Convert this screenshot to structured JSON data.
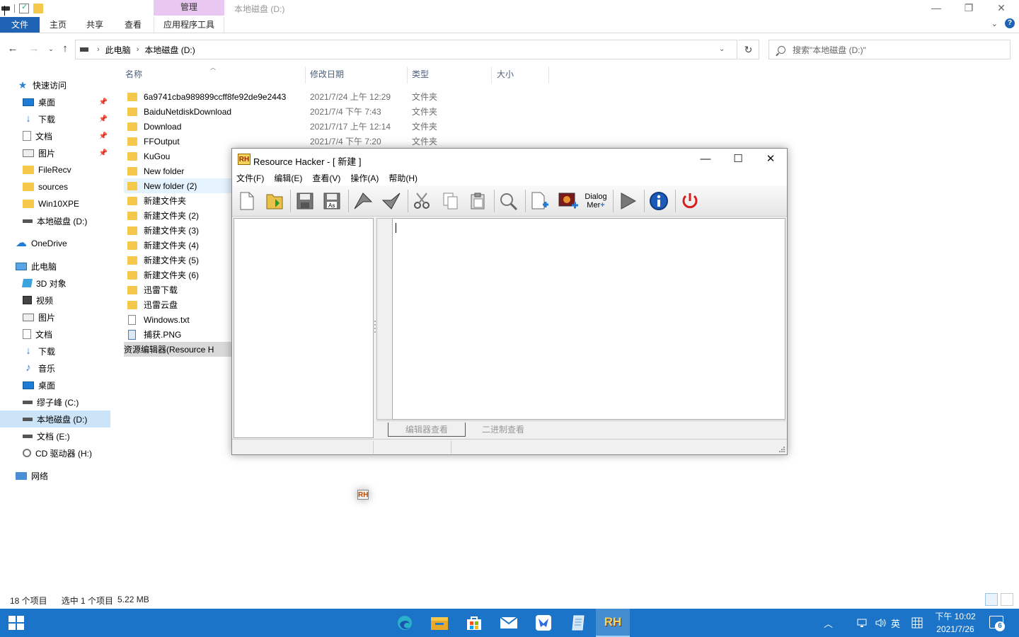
{
  "explorer": {
    "context_tab": "管理",
    "window_title": "本地磁盘 (D:)",
    "ribbon_tabs": [
      "文件",
      "主页",
      "共享",
      "查看",
      "应用程序工具"
    ],
    "breadcrumb": [
      "此电脑",
      "本地磁盘 (D:)"
    ],
    "search_placeholder": "搜索\"本地磁盘 (D:)\"",
    "columns": [
      "名称",
      "修改日期",
      "类型",
      "大小"
    ],
    "nav": [
      {
        "label": "快速访问"
      },
      {
        "label": "桌面"
      },
      {
        "label": "下载"
      },
      {
        "label": "文档"
      },
      {
        "label": "图片"
      },
      {
        "label": "FileRecv"
      },
      {
        "label": "sources"
      },
      {
        "label": "Win10XPE"
      },
      {
        "label": "本地磁盘 (D:)"
      },
      {
        "label": "OneDrive"
      },
      {
        "label": "此电脑"
      },
      {
        "label": "3D 对象"
      },
      {
        "label": "视频"
      },
      {
        "label": "图片"
      },
      {
        "label": "文档"
      },
      {
        "label": "下载"
      },
      {
        "label": "音乐"
      },
      {
        "label": "桌面"
      },
      {
        "label": "缪子峰 (C:)"
      },
      {
        "label": "本地磁盘 (D:)"
      },
      {
        "label": "文档 (E:)"
      },
      {
        "label": "CD 驱动器 (H:)"
      },
      {
        "label": "网络"
      }
    ],
    "files": [
      {
        "name": "6a9741cba989899ccff8fe92de9e2443",
        "date": "2021/7/24 上午 12:29",
        "type": "文件夹"
      },
      {
        "name": "BaiduNetdiskDownload",
        "date": "2021/7/4 下午 7:43",
        "type": "文件夹"
      },
      {
        "name": "Download",
        "date": "2021/7/17 上午 12:14",
        "type": "文件夹"
      },
      {
        "name": "FFOutput",
        "date": "2021/7/4 下午 7:20",
        "type": "文件夹"
      },
      {
        "name": "KuGou",
        "date": "",
        "type": ""
      },
      {
        "name": "New folder",
        "date": "",
        "type": ""
      },
      {
        "name": "New folder (2)",
        "date": "",
        "type": ""
      },
      {
        "name": "新建文件夹",
        "date": "",
        "type": ""
      },
      {
        "name": "新建文件夹 (2)",
        "date": "",
        "type": ""
      },
      {
        "name": "新建文件夹 (3)",
        "date": "",
        "type": ""
      },
      {
        "name": "新建文件夹 (4)",
        "date": "",
        "type": ""
      },
      {
        "name": "新建文件夹 (5)",
        "date": "",
        "type": ""
      },
      {
        "name": "新建文件夹 (6)",
        "date": "",
        "type": ""
      },
      {
        "name": "迅雷下载",
        "date": "",
        "type": ""
      },
      {
        "name": "迅雷云盘",
        "date": "",
        "type": ""
      },
      {
        "name": "Windows.txt",
        "date": "",
        "type": ""
      },
      {
        "name": "捕获.PNG",
        "date": "",
        "type": ""
      },
      {
        "name": "资源编辑器(Resource H",
        "date": "",
        "type": ""
      }
    ],
    "status": {
      "count": "18 个项目",
      "selected": "选中 1 个项目",
      "size": "5.22 MB"
    }
  },
  "rh": {
    "title": "Resource Hacker - [ 新建 ]",
    "logo": "RH",
    "menu": [
      "文件(F)",
      "编辑(E)",
      "查看(V)",
      "操作(A)",
      "帮助(H)"
    ],
    "dialog_merger_label_1": "Dialog",
    "dialog_merger_label_2": "Mer",
    "tabs": [
      "编辑器查看",
      "二进制查看"
    ]
  },
  "taskbar": {
    "ime": "英",
    "time": "下午 10:02",
    "date": "2021/7/26",
    "notifications": "6",
    "rh_label": "RH"
  },
  "colors": {
    "accent": "#1f63b5",
    "taskbar": "#1b74c7",
    "context_tab": "#e8c8f0",
    "folder": "#f5c84b",
    "selection": "#cce4f7"
  }
}
